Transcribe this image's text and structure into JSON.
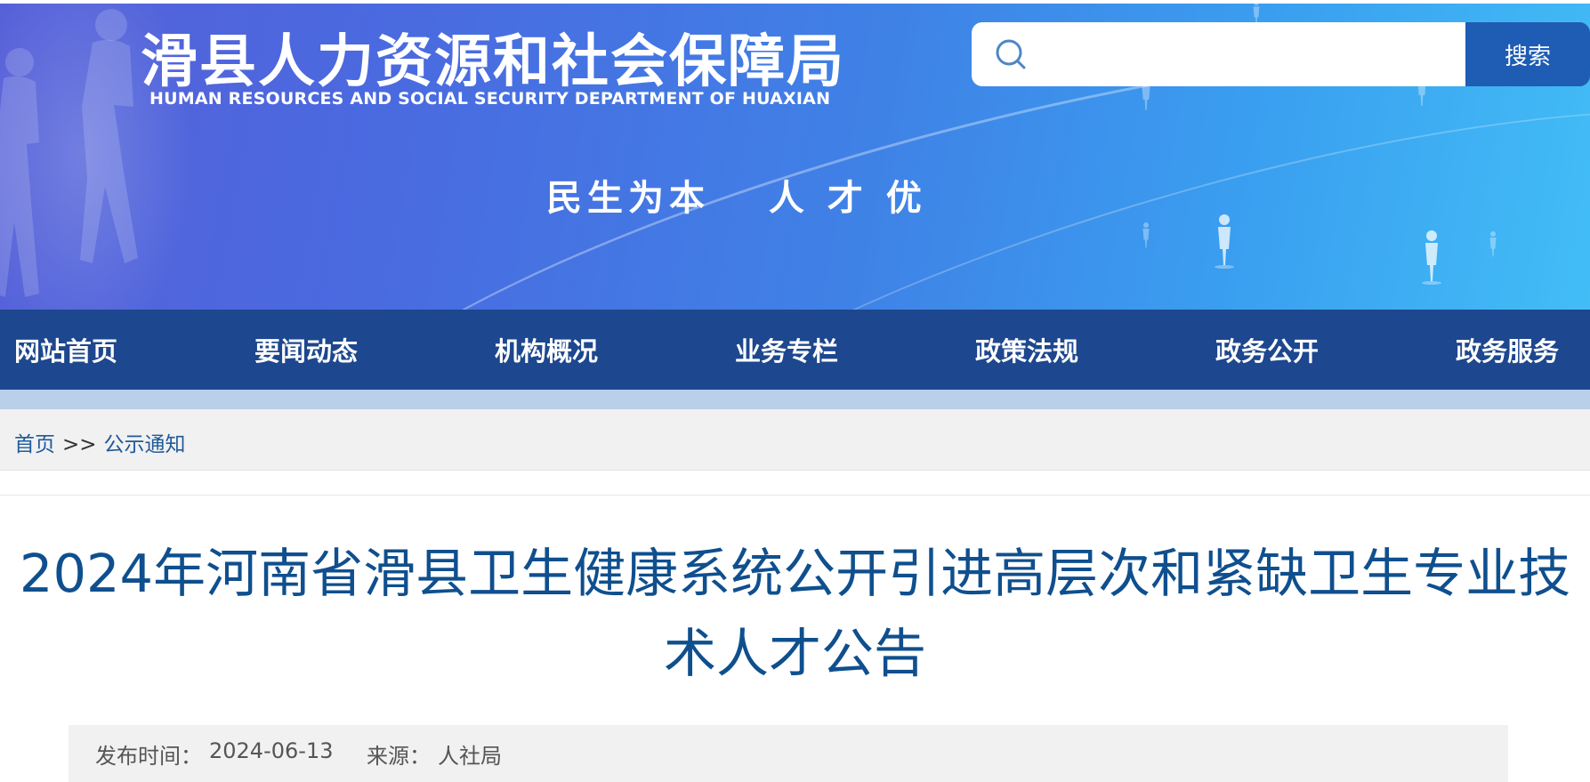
{
  "header": {
    "title": "滑县人力资源和社会保障局",
    "subtitle": "HUMAN RESOURCES AND SOCIAL SECURITY DEPARTMENT OF HUAXIAN",
    "slogan": "民生为本　 人 才 优"
  },
  "search": {
    "icon": "search-icon",
    "value": "",
    "placeholder": "",
    "button_label": "搜索"
  },
  "nav": {
    "items": [
      {
        "label": "网站首页"
      },
      {
        "label": "要闻动态"
      },
      {
        "label": "机构概况"
      },
      {
        "label": "业务专栏"
      },
      {
        "label": "政策法规"
      },
      {
        "label": "政务公开"
      },
      {
        "label": "政务服务"
      }
    ]
  },
  "breadcrumb": {
    "home": "首页",
    "separator": ">>",
    "current": "公示通知"
  },
  "article": {
    "title": "2024年河南省滑县卫生健康系统公开引进高层次和紧缺卫生专业技术人才公告",
    "publish_label": "发布时间：",
    "publish_date": "2024-06-13",
    "source_label": "来源：",
    "source": "人社局"
  },
  "colors": {
    "nav_background": "#1d478e",
    "search_button": "#1f5cb4",
    "title_text": "#0f4f8e",
    "breadcrumb_link": "#205a9b"
  }
}
